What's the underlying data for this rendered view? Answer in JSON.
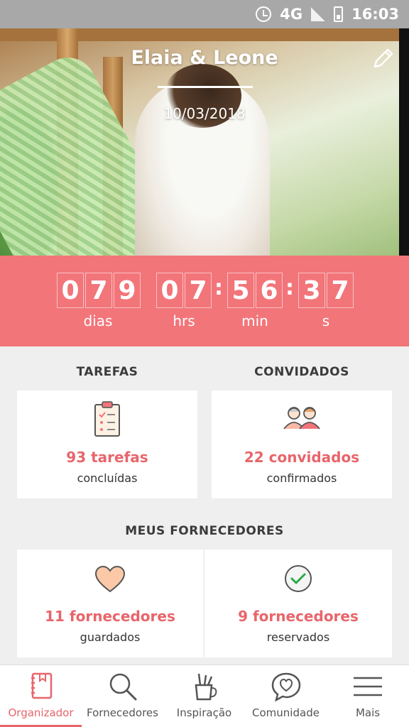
{
  "status_bar": {
    "network": "4G",
    "time": "16:03"
  },
  "hero": {
    "names": "Elaia & Leone",
    "date": "10/03/2018"
  },
  "countdown": {
    "days": [
      "0",
      "7",
      "9"
    ],
    "hours": [
      "0",
      "7"
    ],
    "minutes": [
      "5",
      "6"
    ],
    "seconds": [
      "3",
      "7"
    ],
    "labels": {
      "days": "dias",
      "hours": "hrs",
      "minutes": "min",
      "seconds": "s"
    }
  },
  "tasks": {
    "title": "TAREFAS",
    "count": "93 tarefas",
    "subtitle": "concluídas"
  },
  "guests": {
    "title": "CONVIDADOS",
    "count": "22 convidados",
    "subtitle": "confirmados"
  },
  "vendors": {
    "title": "MEUS FORNECEDORES",
    "saved": {
      "count": "11 fornecedores",
      "subtitle": "guardados"
    },
    "booked": {
      "count": "9 fornecedores",
      "subtitle": "reservados"
    }
  },
  "bottom_nav": {
    "items": [
      {
        "label": "Organizador",
        "icon": "notebook-icon",
        "active": true
      },
      {
        "label": "Fornecedores",
        "icon": "search-icon"
      },
      {
        "label": "Inspiração",
        "icon": "brush-cup-icon"
      },
      {
        "label": "Comunidade",
        "icon": "chat-heart-icon"
      },
      {
        "label": "Mais",
        "icon": "menu-icon"
      }
    ]
  },
  "colors": {
    "accent": "#f2757a",
    "accent_text": "#e8656b",
    "background": "#efefef"
  }
}
